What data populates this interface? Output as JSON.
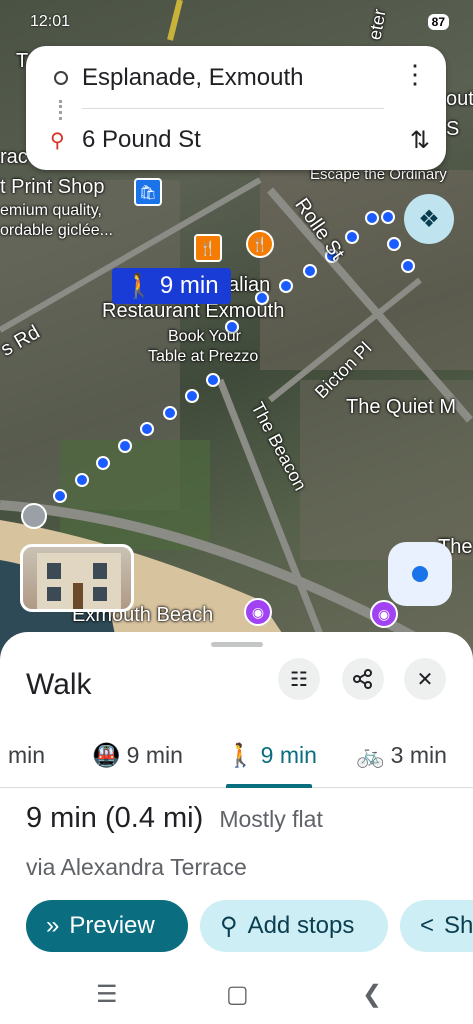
{
  "status_bar": {
    "time": "12:01",
    "battery": "87"
  },
  "route": {
    "origin": "Esplanade, Exmouth",
    "destination": "6 Pound St",
    "more_icon": "more-vert-icon",
    "swap_icon": "swap-vertical-icon"
  },
  "map": {
    "duration_chip": "9 min",
    "labels": {
      "print_shop": "t Print Shop",
      "print_shop_sub1": "emium quality,",
      "print_shop_sub2": "ordable giclée...",
      "italian": "alian",
      "restaurant": "Restaurant Exmouth",
      "restaurant_sub1": "Book Your",
      "restaurant_sub2": "Table at Prezzo",
      "escape": "Escape the Ordinary",
      "rolle_st": "Rolle St",
      "bicton_pl": "Bicton Pl",
      "quiet": "The Quiet M",
      "beacon": "The Beacon",
      "s_rd": "s Rd",
      "beach": "Exmouth Beach",
      "the": "The",
      "rac": "rac",
      "s_frag": "S",
      "out": "out",
      "left_t": "T",
      "eter": "eter"
    }
  },
  "sheet": {
    "mode_title": "Walk",
    "tabs": [
      {
        "label": "min",
        "icon": ""
      },
      {
        "label": "9 min",
        "icon": "transit-icon"
      },
      {
        "label": "9 min",
        "icon": "walk-icon"
      },
      {
        "label": "3 min",
        "icon": "bike-icon"
      }
    ],
    "summary_main": "9 min (0.4 mi)",
    "summary_sub": "Mostly flat",
    "via": "via Alexandra Terrace",
    "actions": {
      "preview": "Preview",
      "add_stops": "Add stops",
      "share": "Sh"
    }
  },
  "colors": {
    "accent": "#0b6e80",
    "route_dots": "#1a5cff",
    "duration_chip": "#1a3cd6",
    "pin": "#d93025"
  }
}
